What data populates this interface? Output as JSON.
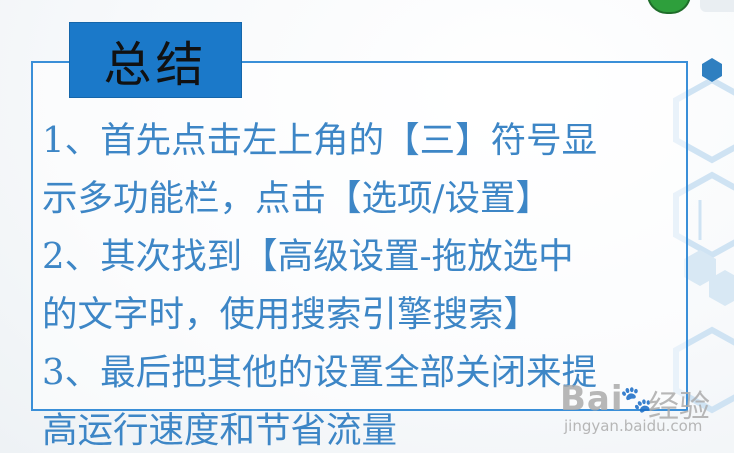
{
  "title": "总结",
  "lines": [
    "1、首先点击左上角的【三】符号显",
    "示多功能栏，点击【选项/设置】",
    "2、其次找到【高级设置-拖放选中",
    "的文字时，使用搜索引擎搜索】",
    "3、最后把其他的设置全部关闭来提",
    "高运行速度和节省流量"
  ],
  "watermark": {
    "logo_text": "Bai",
    "logo_suffix": "经验",
    "url": "jingyan.baidu.com"
  },
  "colors": {
    "text": "#3d86c6",
    "border": "#3a8fd8",
    "title_bg": "#1b79c9",
    "hex_blue": "#2f7fc0"
  }
}
